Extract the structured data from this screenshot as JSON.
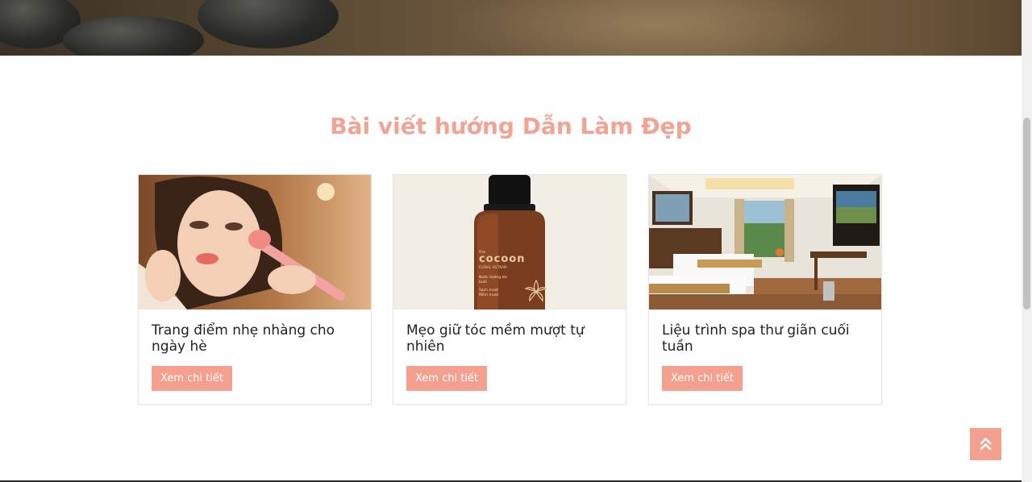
{
  "section": {
    "title": "Bài viết hướng Dẫn Làm Đẹp"
  },
  "posts": [
    {
      "title": "Trang điểm nhẹ nhàng cho ngày hè",
      "button_label": "Xem chi tiết",
      "image": "makeup-portrait"
    },
    {
      "title": "Mẹo giữ tóc mềm mượt tự nhiên",
      "button_label": "Xem chi tiết",
      "image": "cocoon-hair-bottle"
    },
    {
      "title": "Liệu trình spa thư giãn cuối tuần",
      "button_label": "Xem chi tiết",
      "image": "hotel-room"
    }
  ],
  "product_label": {
    "small": "the",
    "brand": "cocoon",
    "tagline": "FLORAL VIETNAM",
    "line1": "Nước dưỡng tóc",
    "line2": "bưởi",
    "line3": "Sạch mượt",
    "line4": "Mềm mượt"
  },
  "back_to_top_icon": "double-chevron-up-icon",
  "colors": {
    "accent": "#f3a08f",
    "title": "#f1a493",
    "text": "#222222"
  }
}
